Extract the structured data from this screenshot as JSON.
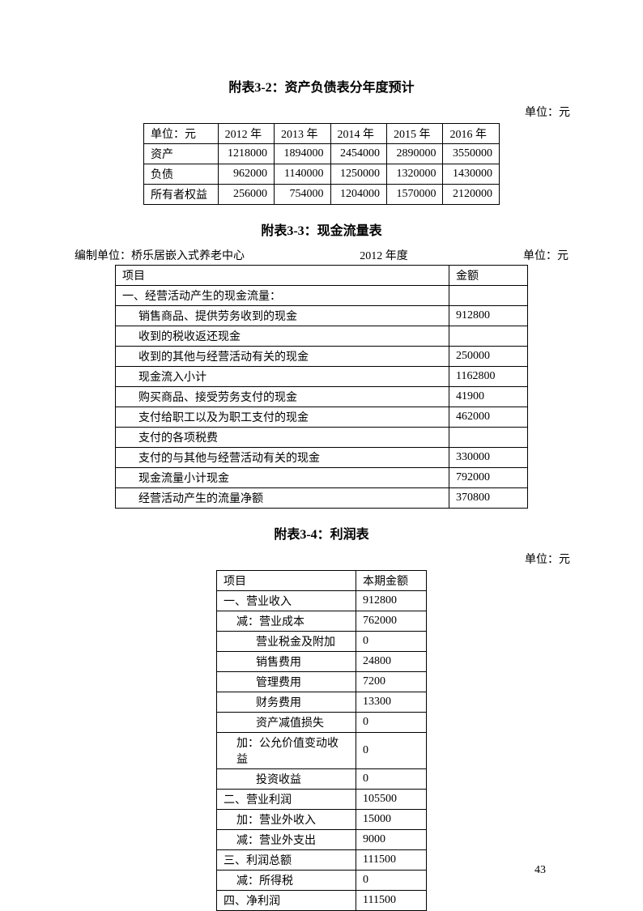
{
  "page_number": "43",
  "section32": {
    "title": "附表3-2：资产负债表分年度预计",
    "unit": "单位：元",
    "header_label": "单位：元",
    "columns": [
      "2012 年",
      "2013 年",
      "2014 年",
      "2015 年",
      "2016 年"
    ],
    "rows": [
      {
        "label": "资产",
        "values": [
          "1218000",
          "1894000",
          "2454000",
          "2890000",
          "3550000"
        ]
      },
      {
        "label": "负债",
        "values": [
          "962000",
          "1140000",
          "1250000",
          "1320000",
          "1430000"
        ]
      },
      {
        "label": "所有者权益",
        "values": [
          "256000",
          "754000",
          "1204000",
          "1570000",
          "2120000"
        ]
      }
    ]
  },
  "section33": {
    "title": "附表3-3：现金流量表",
    "header_left": "编制单位：桥乐居嵌入式养老中心",
    "header_mid": "2012 年度",
    "header_right": "单位：元",
    "col_item": "项目",
    "col_amount": "金额",
    "rows": [
      {
        "label": "一、经营活动产生的现金流量：",
        "amount": "",
        "indent": false
      },
      {
        "label": "销售商品、提供劳务收到的现金",
        "amount": "912800",
        "indent": true
      },
      {
        "label": "收到的税收返还现金",
        "amount": "",
        "indent": true
      },
      {
        "label": "收到的其他与经营活动有关的现金",
        "amount": "250000",
        "indent": true
      },
      {
        "label": "现金流入小计",
        "amount": "1162800",
        "indent": true
      },
      {
        "label": "购买商品、接受劳务支付的现金",
        "amount": "41900",
        "indent": true
      },
      {
        "label": "支付给职工以及为职工支付的现金",
        "amount": "462000",
        "indent": true
      },
      {
        "label": "支付的各项税费",
        "amount": "",
        "indent": true
      },
      {
        "label": "支付的与其他与经营活动有关的现金",
        "amount": "330000",
        "indent": true
      },
      {
        "label": "现金流量小计现金",
        "amount": "792000",
        "indent": true
      },
      {
        "label": "经营活动产生的流量净额",
        "amount": "370800",
        "indent": true
      }
    ]
  },
  "section34": {
    "title": "附表3-4：利润表",
    "unit": "单位：元",
    "col_item": "项目",
    "col_amount": "本期金额",
    "rows": [
      {
        "label": "一、营业收入",
        "amount": "912800",
        "indent": 0
      },
      {
        "label": "减：营业成本",
        "amount": "762000",
        "indent": 1
      },
      {
        "label": "营业税金及附加",
        "amount": "0",
        "indent": 2
      },
      {
        "label": "销售费用",
        "amount": "24800",
        "indent": 2
      },
      {
        "label": "管理费用",
        "amount": "7200",
        "indent": 2
      },
      {
        "label": "财务费用",
        "amount": "13300",
        "indent": 2
      },
      {
        "label": "资产减值损失",
        "amount": "0",
        "indent": 2
      },
      {
        "label": "加：公允价值变动收益",
        "amount": "0",
        "indent": 1
      },
      {
        "label": "投资收益",
        "amount": "0",
        "indent": 2
      },
      {
        "label": "二、营业利润",
        "amount": "105500",
        "indent": 0
      },
      {
        "label": "加：营业外收入",
        "amount": "15000",
        "indent": 1
      },
      {
        "label": "减：营业外支出",
        "amount": "9000",
        "indent": 1
      },
      {
        "label": "三、利润总额",
        "amount": "111500",
        "indent": 0
      },
      {
        "label": "减：所得税",
        "amount": "0",
        "indent": 1
      },
      {
        "label": "四、净利润",
        "amount": "111500",
        "indent": 0
      }
    ]
  }
}
